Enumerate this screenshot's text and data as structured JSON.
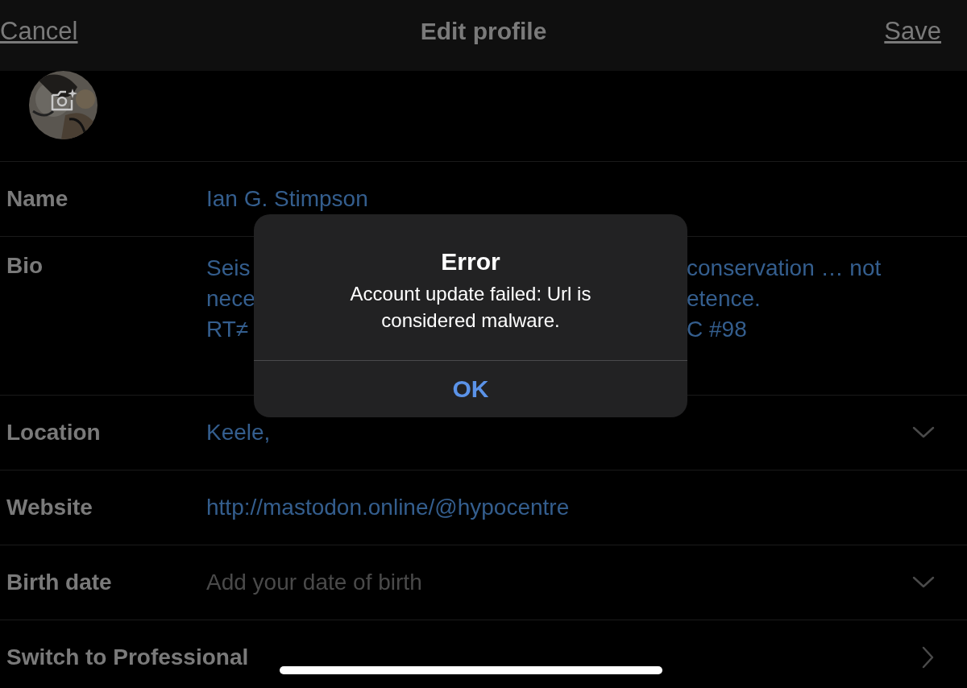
{
  "header": {
    "cancel": "Cancel",
    "title": "Edit profile",
    "save": "Save"
  },
  "fields": [
    {
      "kind": "text",
      "label": "Name",
      "value": "Ian G. Stimpson"
    },
    {
      "kind": "bio",
      "label": "Bio",
      "lines": [
        {
          "left": "Seis",
          "right": "conservation … not"
        },
        {
          "left": "nece",
          "right": "etence."
        },
        {
          "left": "RT≠",
          "right": "C #98"
        }
      ]
    },
    {
      "kind": "select",
      "label": "Location",
      "value": "Keele,"
    },
    {
      "kind": "text",
      "label": "Website",
      "value": "http://mastodon.online/@hypocentre"
    },
    {
      "kind": "select",
      "label": "Birth date",
      "placeholder": "Add your date of birth"
    },
    {
      "kind": "link",
      "label": "Switch to Professional"
    }
  ],
  "dialog": {
    "title": "Error",
    "message": "Account update failed: Url is considered malware.",
    "button": "OK"
  }
}
